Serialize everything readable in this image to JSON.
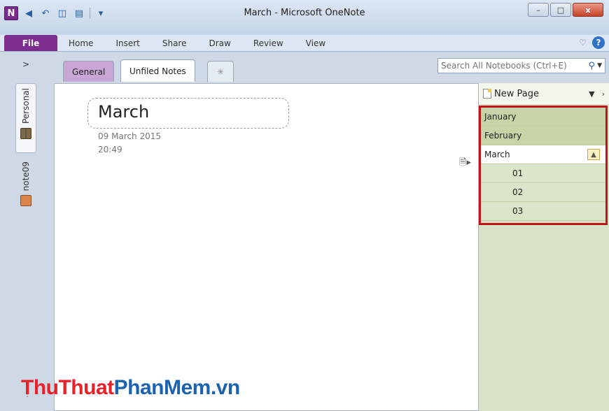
{
  "window": {
    "title": "March - Microsoft OneNote",
    "app_icon": "N",
    "controls": {
      "minimize": "–",
      "maximize": "□",
      "close": "x"
    }
  },
  "ribbon": {
    "file_label": "File",
    "tabs": [
      "Home",
      "Insert",
      "Share",
      "Draw",
      "Review",
      "View"
    ]
  },
  "sections": {
    "expand_label": ">",
    "tabs": [
      "General",
      "Unfiled Notes"
    ],
    "new_section_label": "✳",
    "active": "Unfiled Notes"
  },
  "search": {
    "placeholder": "Search All Notebooks (Ctrl+E)"
  },
  "notebooks": [
    {
      "name": "Personal"
    },
    {
      "name": "note09"
    }
  ],
  "page": {
    "title": "March",
    "date": "09 March 2015",
    "time": "20:49"
  },
  "page_pane": {
    "new_page_label": "New Page",
    "pages": [
      {
        "label": "January",
        "level": 1
      },
      {
        "label": "February",
        "level": 1
      },
      {
        "label": "March",
        "level": 1,
        "active": true
      },
      {
        "label": "01",
        "level": 2
      },
      {
        "label": "02",
        "level": 2
      },
      {
        "label": "03",
        "level": 2
      }
    ]
  },
  "watermark": {
    "part1": "ThuThuat",
    "part2": "PhanMem.vn"
  },
  "colors": {
    "file_tab": "#7d2d8f",
    "section_general": "#c9a6d6",
    "page_pane": "#d9e3c7",
    "highlight_border": "#c0141b"
  }
}
